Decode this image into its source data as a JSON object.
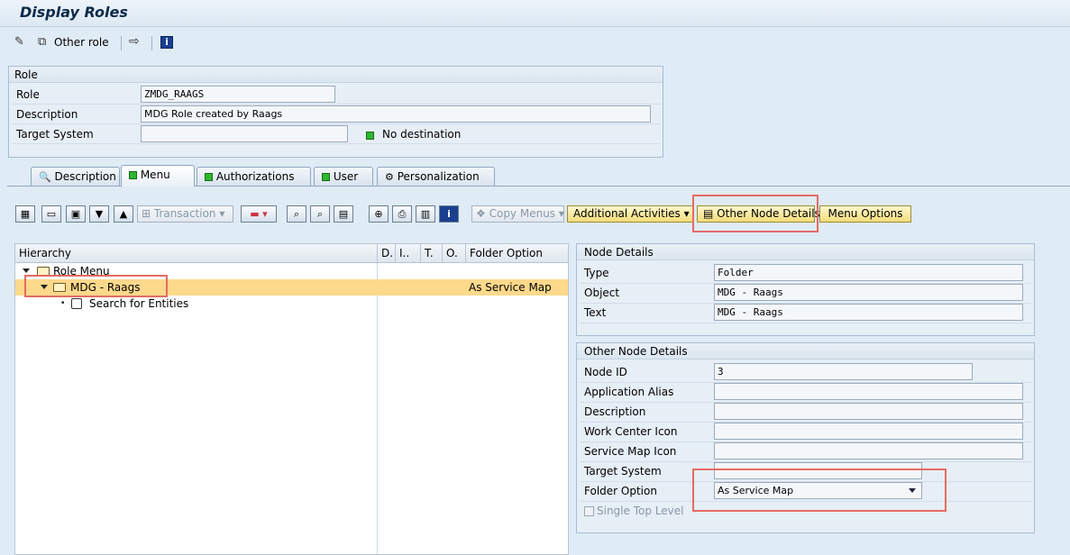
{
  "window": {
    "title": "Display Roles"
  },
  "toolbar": {
    "other_role_label": "Other role"
  },
  "role_box": {
    "header": "Role",
    "role_label": "Role",
    "role_value": "ZMDG_RAAGS",
    "description_label": "Description",
    "description_value": "MDG Role created by Raags",
    "target_system_label": "Target System",
    "target_system_value": "",
    "destination_status": "No destination"
  },
  "tabs": [
    {
      "label": "Description"
    },
    {
      "label": "Menu"
    },
    {
      "label": "Authorizations"
    },
    {
      "label": "User"
    },
    {
      "label": "Personalization"
    }
  ],
  "menu_toolbar": {
    "transaction_label": "Transaction",
    "copy_menus_label": "Copy Menus",
    "additional_activities_label": "Additional Activities",
    "other_node_details_label": "Other Node Details",
    "menu_options_label": "Menu Options"
  },
  "hierarchy": {
    "columns": [
      "Hierarchy",
      "D.",
      "I..",
      "T.",
      "O.",
      "Folder Option"
    ],
    "rows": [
      {
        "label": "Role Menu",
        "folder_option": ""
      },
      {
        "label": "MDG - Raags",
        "folder_option": "As Service Map"
      },
      {
        "label": "Search for Entities",
        "folder_option": ""
      }
    ]
  },
  "node_details": {
    "header": "Node Details",
    "type_label": "Type",
    "type_value": "Folder",
    "object_label": "Object",
    "object_value": "MDG - Raags",
    "text_label": "Text",
    "text_value": "MDG - Raags"
  },
  "other_node_details": {
    "header": "Other Node Details",
    "node_id_label": "Node ID",
    "node_id_value": "3",
    "application_alias_label": "Application Alias",
    "application_alias_value": "",
    "description_label": "Description",
    "description_value": "",
    "work_center_icon_label": "Work Center Icon",
    "work_center_icon_value": "",
    "service_map_icon_label": "Service Map Icon",
    "service_map_icon_value": "",
    "target_system_label": "Target System",
    "target_system_value": "",
    "folder_option_label": "Folder Option",
    "folder_option_value": "As Service Map",
    "single_top_level_label": "Single Top Level"
  },
  "colors": {
    "selection": "#fcd98b",
    "highlight_box": "#e46b64",
    "button_yellow": "#f3dc79"
  }
}
